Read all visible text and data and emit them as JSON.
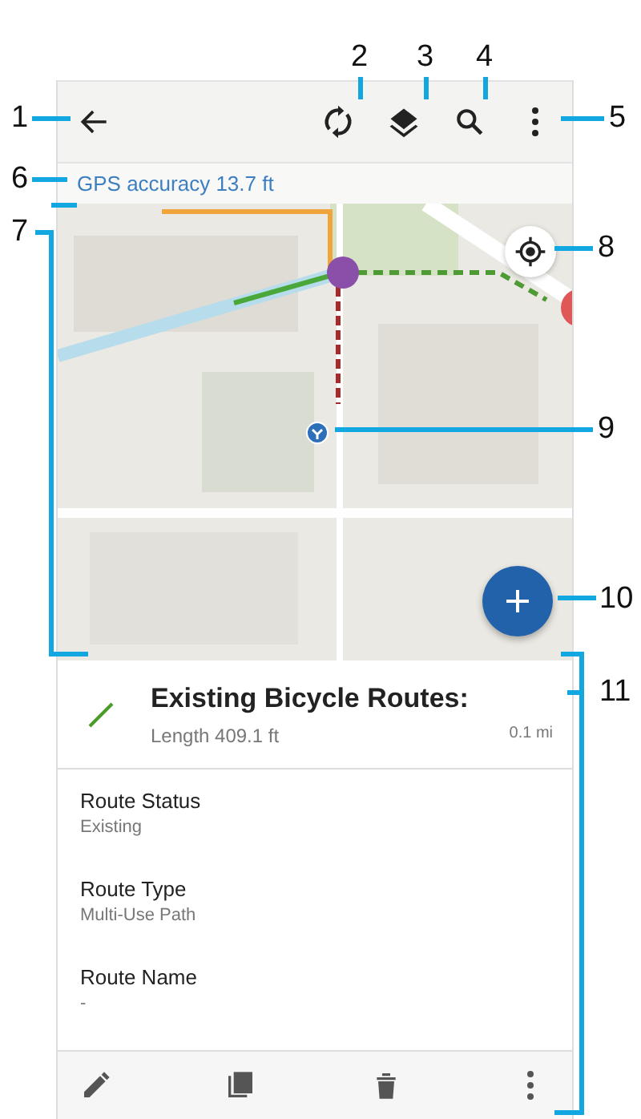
{
  "callouts": [
    {
      "number": "1"
    },
    {
      "number": "2"
    },
    {
      "number": "3"
    },
    {
      "number": "4"
    },
    {
      "number": "5"
    },
    {
      "number": "6"
    },
    {
      "number": "7"
    },
    {
      "number": "8"
    },
    {
      "number": "9"
    },
    {
      "number": "10"
    },
    {
      "number": "11"
    }
  ],
  "gps_bar": {
    "text": "GPS accuracy 13.7 ft"
  },
  "feature_card": {
    "title": "Existing Bicycle Routes:",
    "length": "Length 409.1 ft",
    "distance": "0.1 mi",
    "fields": [
      {
        "label": "Route Status",
        "value": "Existing"
      },
      {
        "label": "Route Type",
        "value": "Multi-Use Path"
      },
      {
        "label": "Route Name",
        "value": "-"
      }
    ]
  }
}
